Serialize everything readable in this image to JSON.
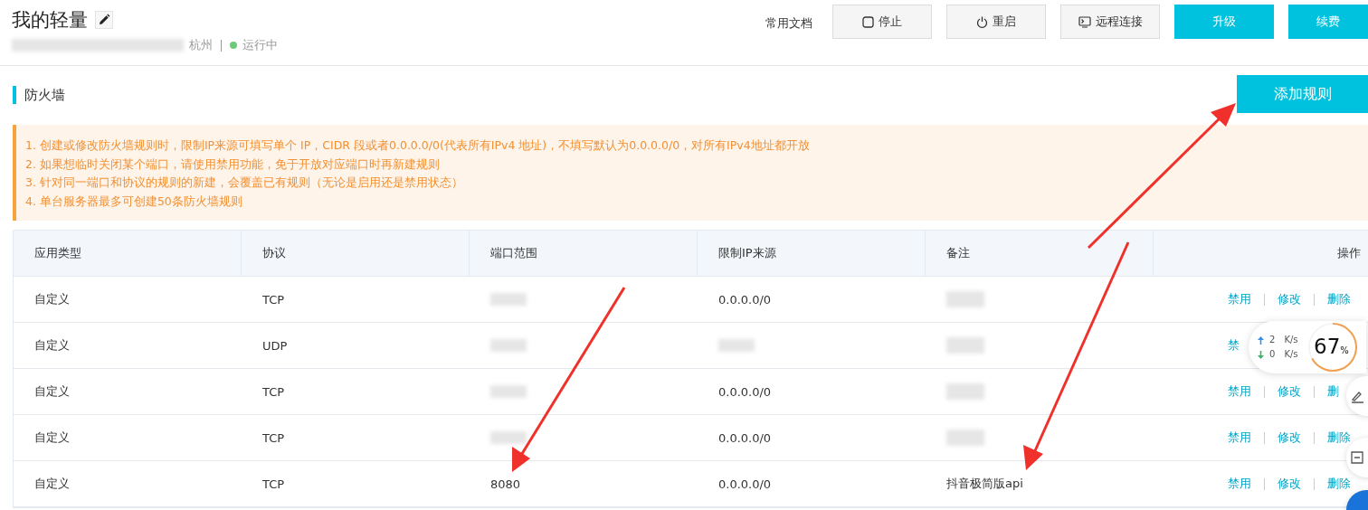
{
  "header": {
    "title": "我的轻量",
    "region": "杭州",
    "status": "运行中",
    "running": true,
    "docs_link": "常用文档",
    "buttons": [
      {
        "label": "停止",
        "kind": "stop"
      },
      {
        "label": "重启",
        "kind": "restart"
      },
      {
        "label": "远程连接",
        "kind": "remote"
      },
      {
        "label": "升级",
        "kind": "primary"
      },
      {
        "label": "续费",
        "kind": "primary"
      }
    ]
  },
  "section": {
    "title": "防火墙",
    "add_button": "添加规则"
  },
  "notice": [
    "1. 创建或修改防火墙规则时，限制IP来源可填写单个 IP，CIDR 段或者0.0.0.0/0(代表所有IPv4 地址)，不填写默认为0.0.0.0/0，对所有IPv4地址都开放",
    "2. 如果想临时关闭某个端口，请使用禁用功能，免于开放对应端口时再新建规则",
    "3. 针对同一端口和协议的规则的新建，会覆盖已有规则（无论是启用还是禁用状态）",
    "4. 单台服务器最多可创建50条防火墙规则"
  ],
  "table": {
    "columns": [
      "应用类型",
      "协议",
      "端口范围",
      "限制IP来源",
      "备注",
      "操作"
    ],
    "rows": [
      {
        "type": "自定义",
        "protocol": "TCP",
        "port": null,
        "source": "0.0.0.0/0",
        "note": null,
        "actions": [
          "禁用",
          "修改",
          "删除"
        ]
      },
      {
        "type": "自定义",
        "protocol": "UDP",
        "port": null,
        "source": null,
        "note": null,
        "actions": [
          "禁"
        ]
      },
      {
        "type": "自定义",
        "protocol": "TCP",
        "port": null,
        "source": "0.0.0.0/0",
        "note": null,
        "actions": [
          "禁用",
          "修改",
          "删"
        ]
      },
      {
        "type": "自定义",
        "protocol": "TCP",
        "port": null,
        "source": "0.0.0.0/0",
        "note": null,
        "actions": [
          "禁用",
          "修改",
          "删除"
        ]
      },
      {
        "type": "自定义",
        "protocol": "TCP",
        "port": "8080",
        "source": "0.0.0.0/0",
        "note": "抖音极简版api",
        "actions": [
          "禁用",
          "修改",
          "删除"
        ]
      }
    ]
  },
  "net_widget": {
    "up": "2",
    "down": "0",
    "unit_up": "K/s",
    "unit_down": "K/s",
    "percent": "67",
    "percent_sign": "%"
  }
}
